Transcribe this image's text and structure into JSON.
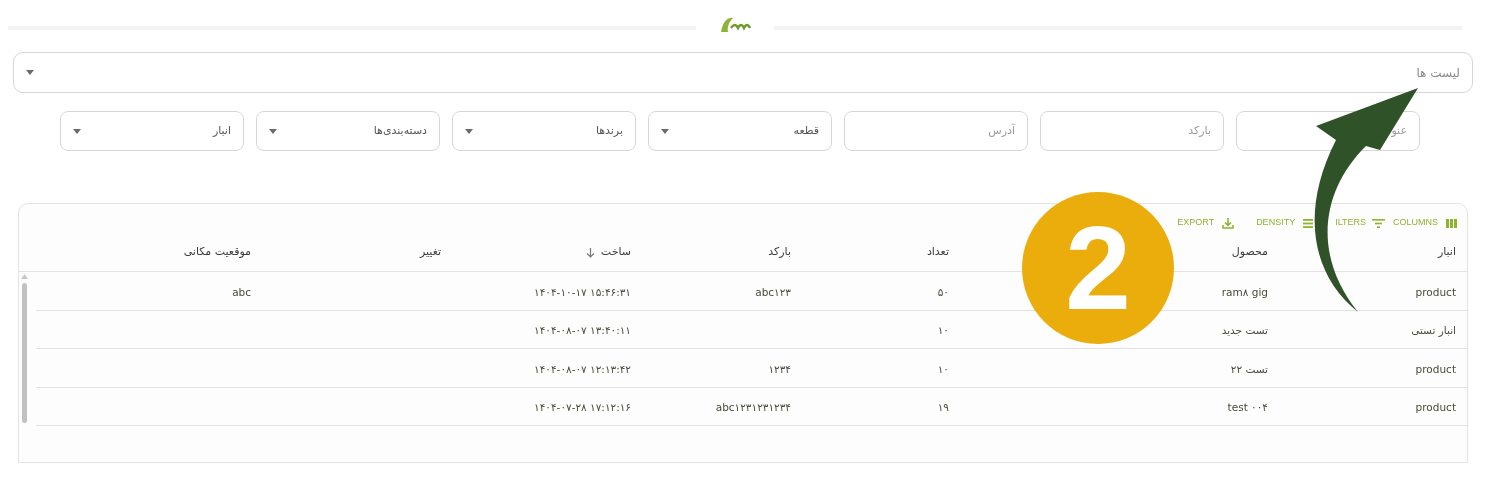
{
  "list_select": {
    "placeholder": "لیست ها"
  },
  "filters": [
    {
      "kind": "text",
      "placeholder": "عنو"
    },
    {
      "kind": "text",
      "placeholder": "بارکد"
    },
    {
      "kind": "text",
      "placeholder": "آدرس"
    },
    {
      "kind": "select",
      "placeholder": "قطعه"
    },
    {
      "kind": "select",
      "placeholder": "برندها"
    },
    {
      "kind": "select",
      "placeholder": "دسته‌بندی‌ها"
    },
    {
      "kind": "select",
      "placeholder": "انبار"
    }
  ],
  "toolbar": [
    {
      "kind": "columns",
      "label": "COLUMNS"
    },
    {
      "kind": "filters",
      "label": "ILTERS"
    },
    {
      "kind": "density",
      "label": "DENSITY"
    },
    {
      "kind": "export",
      "label": "EXPORT"
    }
  ],
  "table": {
    "columns": [
      {
        "label": "انبار",
        "sorted": false
      },
      {
        "label": "محصول",
        "sorted": false
      },
      {
        "label": "تعداد",
        "sorted": false
      },
      {
        "label": "بارکد",
        "sorted": false
      },
      {
        "label": "ساخت",
        "sorted": true
      },
      {
        "label": "تغییر",
        "sorted": false
      },
      {
        "label": "موقعیت مکانی",
        "sorted": false
      }
    ],
    "rows": [
      [
        "product",
        "ram۸ gig",
        "۵۰",
        "abc۱۲۳",
        "۱۴۰۴-۱۰-۱۷ ۱۵:۴۶:۳۱",
        "",
        "abc"
      ],
      [
        "انبار تستی",
        "تست جدید",
        "۱۰",
        "",
        "۱۴۰۴-۰۸-۰۷ ۱۳:۴۰:۱۱",
        "",
        ""
      ],
      [
        "product",
        "تست ۲۲",
        "۱۰",
        "۱۲۳۴",
        "۱۴۰۴-۰۸-۰۷ ۱۲:۱۳:۴۲",
        "",
        ""
      ],
      [
        "product",
        "test ۰۰۴",
        "۱۹",
        "abc۱۲۳۱۲۳۱۲۳۴",
        "۱۴۰۴-۰۷-۲۸ ۱۷:۱۲:۱۶",
        "",
        ""
      ]
    ]
  },
  "annotation": {
    "number": "2"
  }
}
